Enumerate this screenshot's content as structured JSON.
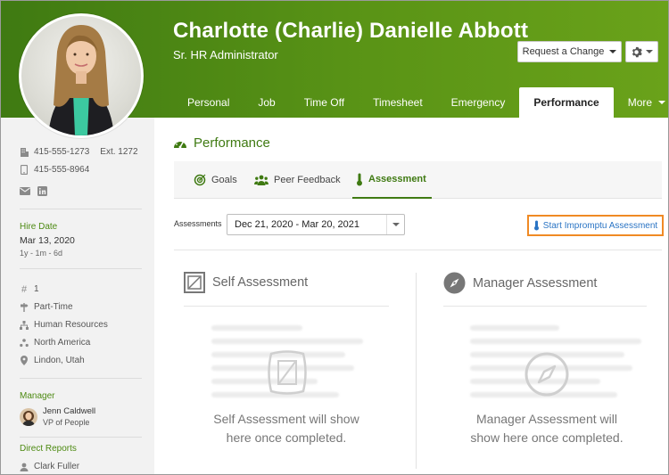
{
  "employee": {
    "name": "Charlotte (Charlie) Danielle Abbott",
    "title": "Sr. HR Administrator"
  },
  "header": {
    "request_change_label": "Request a Change",
    "settings_icon": "gear-icon"
  },
  "tabs": [
    {
      "label": "Personal",
      "active": false
    },
    {
      "label": "Job",
      "active": false
    },
    {
      "label": "Time Off",
      "active": false
    },
    {
      "label": "Timesheet",
      "active": false
    },
    {
      "label": "Emergency",
      "active": false
    },
    {
      "label": "Performance",
      "active": true
    },
    {
      "label": "More",
      "active": false
    }
  ],
  "sidebar": {
    "work_phone": "415-555-1273",
    "extension": "Ext. 1272",
    "mobile_phone": "415-555-8964",
    "hire_date_label": "Hire Date",
    "hire_date": "Mar 13, 2020",
    "tenure": "1y - 1m - 6d",
    "employee_number": "1",
    "employment_type": "Part-Time",
    "department": "Human Resources",
    "division": "North America",
    "location": "Lindon, Utah",
    "manager_label": "Manager",
    "manager_name": "Jenn Caldwell",
    "manager_title": "VP of People",
    "direct_reports_label": "Direct Reports",
    "direct_report_1": "Clark Fuller"
  },
  "performance": {
    "title": "Performance",
    "subtabs": [
      {
        "label": "Goals",
        "active": false
      },
      {
        "label": "Peer Feedback",
        "active": false
      },
      {
        "label": "Assessment",
        "active": true
      }
    ],
    "assessments_label": "Assessments",
    "assessment_period": "Dec 21, 2020 - Mar 20, 2021",
    "impromptu_label": "Start Impromptu Assessment",
    "self_title": "Self Assessment",
    "manager_title": "Manager Assessment",
    "self_empty_line1": "Self Assessment will show",
    "self_empty_line2": "here once completed.",
    "manager_empty_line1": "Manager Assessment will",
    "manager_empty_line2": "show here once completed."
  },
  "colors": {
    "brand_green": "#4d8a12",
    "highlight_orange": "#f08a24",
    "link_blue": "#2a74c4"
  }
}
